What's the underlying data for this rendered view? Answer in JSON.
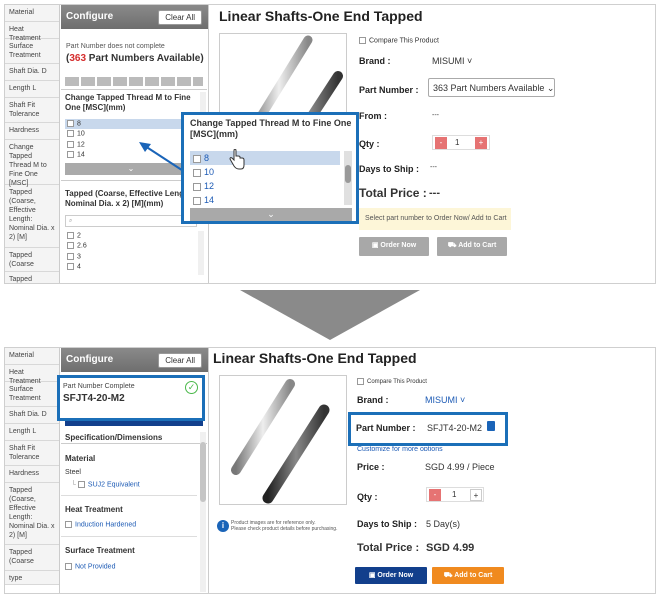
{
  "colors": {
    "accent": "#1a64b8",
    "red": "#d52c2c",
    "orange": "#f08a1f",
    "navy": "#123f8c",
    "highlight_border": "#1b6fb8",
    "check_green": "#4ab84a"
  },
  "before": {
    "sidebar": [
      "Material",
      "Heat Treatment",
      "Surface Treatment",
      "Shaft Dia. D",
      "Length L",
      "Shaft Fit Tolerance",
      "Hardness",
      "Change Tapped Thread M to Fine One [MSC]",
      "Tapped (Coarse, Effective Length: Nominal Dia. x 2) [M]",
      "Tapped (Coarse",
      "Tapped"
    ],
    "configure": "Configure",
    "clear_all": "Clear All",
    "status_prefix": "Part Number does not complete",
    "count": "363",
    "count_suffix": " Part Numbers Available)",
    "count_open": "(",
    "sec1_title": "Change Tapped Thread M to Fine One [MSC](mm)",
    "sec1_opts": [
      "8",
      "10",
      "12",
      "14"
    ],
    "sec2_title": "Tapped (Coarse, Effective Length: Nominal Dia. x 2) [M](mm)",
    "sec2_opts": [
      "2",
      "2.6",
      "3",
      "4"
    ],
    "popup_title": "Change Tapped Thread M to Fine One [MSC](mm)",
    "popup_opts": [
      "8",
      "10",
      "12",
      "14"
    ],
    "product_title": "Linear Shafts-One End Tapped",
    "compare": "Compare This Product",
    "brand_label": "Brand :",
    "brand_value": "MISUMI",
    "part_label": "Part Number :",
    "part_value": "363 Part Numbers Available",
    "from_label": "From :",
    "from_value": "---",
    "qty_label": "Qty :",
    "qty_value": "1",
    "ship_label": "Days to Ship :",
    "ship_value": "---",
    "total_label": "Total Price :",
    "total_value": "---",
    "notice": "Select part number to Order Now/ Add to Cart",
    "order_now": "Order Now",
    "add_cart": "Add to Cart"
  },
  "after": {
    "sidebar": [
      "Material",
      "Heat Treatment",
      "Surface Treatment",
      "Shaft Dia. D",
      "Length L",
      "Shaft Fit Tolerance",
      "Hardness",
      "Tapped (Coarse, Effective Length: Nominal Dia. x 2) [M]",
      "Tapped (Coarse",
      "type"
    ],
    "configure": "Configure",
    "clear_all": "Clear All",
    "status": "Part Number Complete",
    "part_no": "SFJT4-20-M2",
    "spec_tab": "Specification/Dimensions",
    "material_head": "Material",
    "steel": "Steel",
    "suj2": "SUJ2 Equivalent",
    "heat_head": "Heat Treatment",
    "induction": "Induction Hardened",
    "surface_head": "Surface Treatment",
    "not_provided": "Not Provided",
    "product_title": "Linear Shafts-One End Tapped",
    "compare": "Compare This Product",
    "brand_label": "Brand :",
    "brand_value": "MISUMI",
    "part_label": "Part Number :",
    "part_value": "SFJT4-20-M2",
    "more_options": "Customize  for more options",
    "price_label": "Price :",
    "price_value": "SGD 4.99 / Piece",
    "qty_label": "Qty :",
    "qty_value": "1",
    "ship_label": "Days to Ship :",
    "ship_value": "5 Day(s)",
    "total_label": "Total Price :",
    "total_value": "SGD 4.99",
    "disclaimer1": "Product images are for reference only.",
    "disclaimer2": "Please check product details before purchasing.",
    "order_now": "Order Now",
    "add_cart": "Add to Cart"
  }
}
